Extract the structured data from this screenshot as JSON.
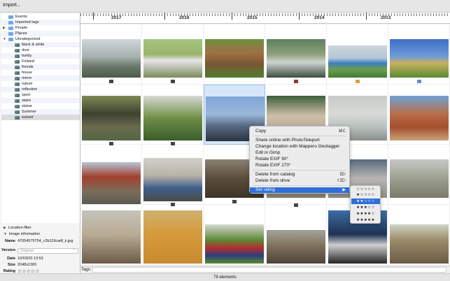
{
  "toolbar": {
    "import_label": "Import..."
  },
  "sidebar": {
    "tags": [
      {
        "label": "Events",
        "icon": "folder-icon"
      },
      {
        "label": "Imported tags",
        "icon": "folder-icon"
      },
      {
        "label": "People",
        "icon": "folder-icon"
      },
      {
        "label": "Places",
        "icon": "folder-icon"
      },
      {
        "label": "Uncategorized",
        "icon": "folder-icon"
      },
      {
        "label": "black & white",
        "icon": "tag-image-icon"
      },
      {
        "label": "door",
        "icon": "tag-image-icon"
      },
      {
        "label": "family",
        "icon": "tag-image-icon"
      },
      {
        "label": "Finland",
        "icon": "tag-image-icon"
      },
      {
        "label": "friends",
        "icon": "tag-image-icon"
      },
      {
        "label": "house",
        "icon": "tag-image-icon"
      },
      {
        "label": "mirror",
        "icon": "tag-image-icon"
      },
      {
        "label": "nature",
        "icon": "tag-image-icon"
      },
      {
        "label": "reflection",
        "icon": "tag-image-icon"
      },
      {
        "label": "sport",
        "icon": "tag-image-icon"
      },
      {
        "label": "stairs",
        "icon": "tag-image-icon"
      },
      {
        "label": "statue",
        "icon": "tag-image-icon"
      },
      {
        "label": "Summer",
        "icon": "tag-image-icon"
      },
      {
        "label": "sunset",
        "icon": "tag-image-icon"
      }
    ],
    "location_filter_label": "Location filter",
    "image_information_label": "Image information",
    "info": {
      "name_key": "Name",
      "name_value": "4705457975­4_c2b119cadf_k.jpg",
      "version_key": "Version",
      "version_value": "Original",
      "date_key": "Date",
      "date_value": "10/03/20 13:53",
      "size_key": "Size",
      "size_value": "2048x1365",
      "rating_key": "Rating",
      "rating_value": "☆☆☆☆☆"
    }
  },
  "timeline": {
    "years": [
      "2017",
      "2016",
      "2015",
      "2014",
      "2013"
    ]
  },
  "context_menu": {
    "copy": "Copy",
    "copy_shortcut": "⌘C",
    "share": "Share online with PhotoTeleport",
    "change_location": "Change location with Mappero Geotagger",
    "edit_gimp": "Edit in Gimp",
    "rotate_90": "Rotate EXIF 90°",
    "rotate_270": "Rotate EXIF 270°",
    "delete_catalog": "Delete from catalog",
    "delete_catalog_shortcut": "⌦",
    "delete_drive": "Delete from drive",
    "delete_drive_shortcut": "⇧⌦",
    "set_rating": "Set rating",
    "set_rating_arrow": "▶"
  },
  "rating_menu": [
    "☆☆☆☆☆",
    "★☆☆☆☆",
    "★★☆☆☆",
    "★★★☆☆",
    "★★★★☆",
    "★★★★★"
  ],
  "tags_label": "Tags:",
  "status": "79 elements"
}
